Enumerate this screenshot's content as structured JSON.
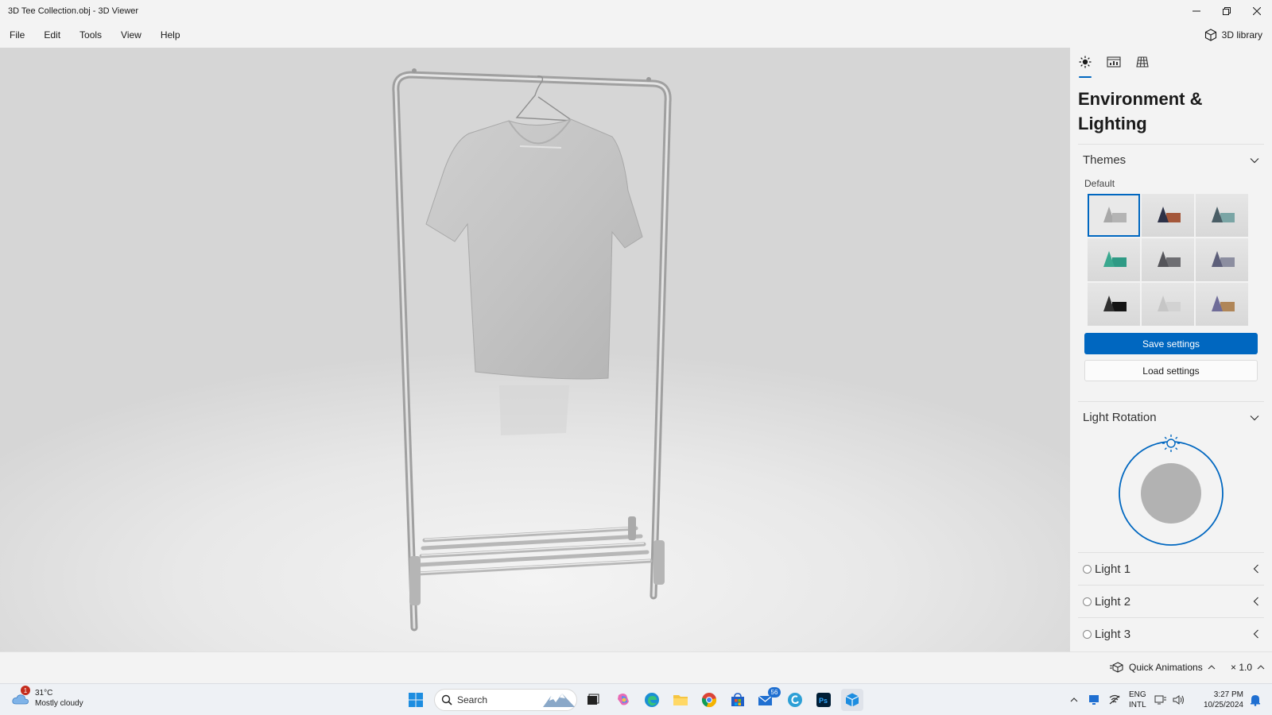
{
  "window": {
    "title": "3D Tee Collection.obj - 3D Viewer"
  },
  "menu": {
    "items": [
      "File",
      "Edit",
      "Tools",
      "View",
      "Help"
    ],
    "library_label": "3D library"
  },
  "panel": {
    "title": "Environment & Lighting",
    "themes": {
      "header": "Themes",
      "group_label": "Default",
      "selected_index": 0
    },
    "save_label": "Save settings",
    "load_label": "Load settings",
    "light_rotation": {
      "header": "Light Rotation"
    },
    "lights": [
      "Light 1",
      "Light 2",
      "Light 3"
    ]
  },
  "statusbar": {
    "quick_animations": "Quick Animations",
    "speed": "× 1.0"
  },
  "taskbar": {
    "weather_temp": "31°C",
    "weather_desc": "Mostly cloudy",
    "weather_badge": "1",
    "search_placeholder": "Search",
    "mail_badge": "56",
    "lang_top": "ENG",
    "lang_bottom": "INTL",
    "time": "3:27 PM",
    "date": "10/25/2024"
  },
  "colors": {
    "accent": "#0067c0",
    "panel_bg": "#f3f3f3",
    "viewport_bg": "#e3e3e3"
  }
}
